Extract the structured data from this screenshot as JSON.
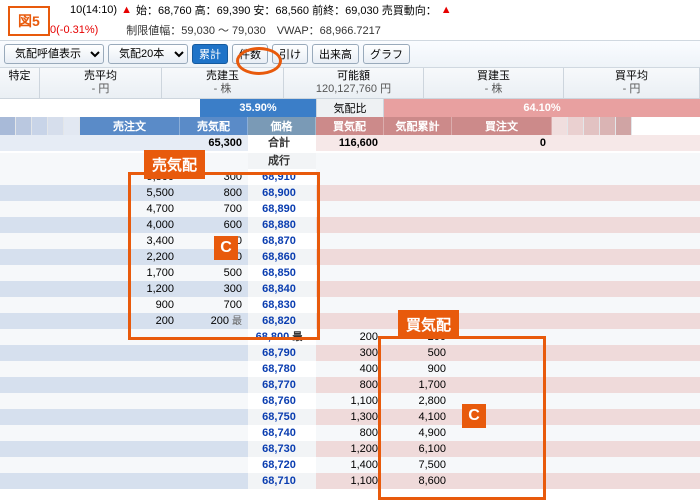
{
  "figure_badge": "図5",
  "top": {
    "time_part": "10(14:10)",
    "tri": "▲",
    "ohlc": "始：68,760  高：69,390  安：68,560  前終：69,030  売買動向：",
    "tri2": "▲",
    "line2_left": "0(-0.31%)",
    "line2_right": "制限値幅：59,030 ～ 79,030　VWAP：68,966.7217"
  },
  "toolbar": {
    "mode_label": "気配呼値表示",
    "kehai_label": "気配20本",
    "btn_ruikei": "累計",
    "btn_kensu": "件数",
    "btn_hike": "引け",
    "btn_dekidaka": "出来高",
    "btn_graph": "グラフ"
  },
  "headers": {
    "tokutei": "特定",
    "sell_avg": "売平均",
    "sell_avg_sub": "- 円",
    "sell_pos": "売建玉",
    "sell_pos_sub": "- 株",
    "kano": "可能額",
    "kano_sub": "120,127,760 円",
    "buy_pos": "買建玉",
    "buy_pos_sub": "- 株",
    "buy_avg": "買平均",
    "buy_avg_sub": "- 円"
  },
  "ratio": {
    "left": "35.90%",
    "mid": "気配比",
    "right": "64.10%"
  },
  "colhead": {
    "sell_order": "売注文",
    "sell_kehai": "売気配",
    "price": "価格",
    "buy_kehai": "買気配",
    "kehai_ruikei": "気配累計",
    "buy_order": "買注文"
  },
  "sum_row": {
    "sell_kehai": "65,300",
    "price_label": "合計",
    "buy_kehai": "116,600",
    "buy_order": "0"
  },
  "nariyuki": "成行",
  "rows": [
    {
      "so": "5,800",
      "sk": "300",
      "p": "68,910",
      "bk": "",
      "kr": "",
      "bo": ""
    },
    {
      "so": "5,500",
      "sk": "800",
      "p": "68,900",
      "bk": "",
      "kr": "",
      "bo": ""
    },
    {
      "so": "4,700",
      "sk": "700",
      "p": "68,890",
      "bk": "",
      "kr": "",
      "bo": ""
    },
    {
      "so": "4,000",
      "sk": "600",
      "p": "68,880",
      "bk": "",
      "kr": "",
      "bo": ""
    },
    {
      "so": "3,400",
      "sk": "1,200",
      "p": "68,870",
      "bk": "",
      "kr": "",
      "bo": ""
    },
    {
      "so": "2,200",
      "sk": "500",
      "p": "68,860",
      "bk": "",
      "kr": "",
      "bo": ""
    },
    {
      "so": "1,700",
      "sk": "500",
      "p": "68,850",
      "bk": "",
      "kr": "",
      "bo": ""
    },
    {
      "so": "1,200",
      "sk": "300",
      "p": "68,840",
      "bk": "",
      "kr": "",
      "bo": ""
    },
    {
      "so": "900",
      "sk": "700",
      "p": "68,830",
      "bk": "",
      "kr": "",
      "bo": ""
    },
    {
      "so": "200",
      "sk": "200",
      "p": "68,820",
      "bk": "",
      "kr": "",
      "bo": "",
      "mark_l": "最"
    },
    {
      "so": "",
      "sk": "",
      "p": "68,800",
      "bk": "200",
      "kr": "200",
      "bo": "",
      "mark_r": "最"
    },
    {
      "so": "",
      "sk": "",
      "p": "68,790",
      "bk": "300",
      "kr": "500",
      "bo": ""
    },
    {
      "so": "",
      "sk": "",
      "p": "68,780",
      "bk": "400",
      "kr": "900",
      "bo": ""
    },
    {
      "so": "",
      "sk": "",
      "p": "68,770",
      "bk": "800",
      "kr": "1,700",
      "bo": ""
    },
    {
      "so": "",
      "sk": "",
      "p": "68,760",
      "bk": "1,100",
      "kr": "2,800",
      "bo": ""
    },
    {
      "so": "",
      "sk": "",
      "p": "68,750",
      "bk": "1,300",
      "kr": "4,100",
      "bo": ""
    },
    {
      "so": "",
      "sk": "",
      "p": "68,740",
      "bk": "800",
      "kr": "4,900",
      "bo": ""
    },
    {
      "so": "",
      "sk": "",
      "p": "68,730",
      "bk": "1,200",
      "kr": "6,100",
      "bo": ""
    },
    {
      "so": "",
      "sk": "",
      "p": "68,720",
      "bk": "1,400",
      "kr": "7,500",
      "bo": ""
    },
    {
      "so": "",
      "sk": "",
      "p": "68,710",
      "bk": "1,100",
      "kr": "8,600",
      "bo": ""
    }
  ],
  "overlays": {
    "sell_label": "売気配",
    "buy_label": "買気配",
    "c": "C"
  }
}
